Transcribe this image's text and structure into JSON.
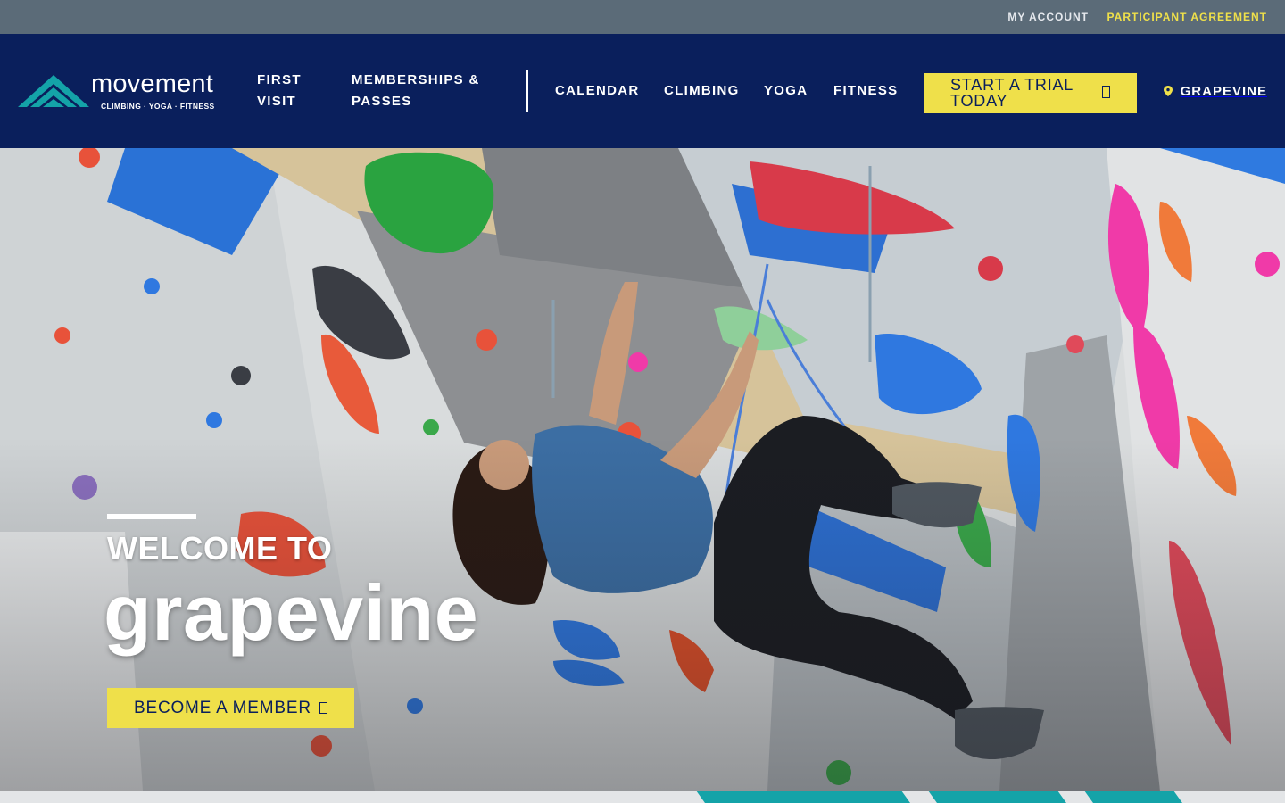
{
  "topbar": {
    "my_account": "MY ACCOUNT",
    "participant_agreement": "PARTICIPANT AGREEMENT"
  },
  "logo": {
    "wordmark": "movement",
    "tagline": "CLIMBING · YOGA · FITNESS"
  },
  "nav": {
    "first_visit": "FIRST VISIT",
    "memberships": "MEMBERSHIPS & PASSES",
    "calendar": "CALENDAR",
    "climbing": "CLIMBING",
    "yoga": "YOGA",
    "fitness": "FITNESS",
    "trial_button": "START A TRIAL TODAY",
    "location": "GRAPEVINE"
  },
  "hero": {
    "welcome": "WELCOME TO",
    "title": "grapevine",
    "cta": "BECOME A MEMBER"
  },
  "icons": {
    "trial_arrow": "arrow-icon",
    "member_arrow": "arrow-icon",
    "location": "map-pin-icon"
  },
  "colors": {
    "topbar_bg": "#5b6b78",
    "nav_bg": "#0a1f5c",
    "accent_yellow": "#efe04a",
    "logo_teal": "#14a3a8"
  }
}
